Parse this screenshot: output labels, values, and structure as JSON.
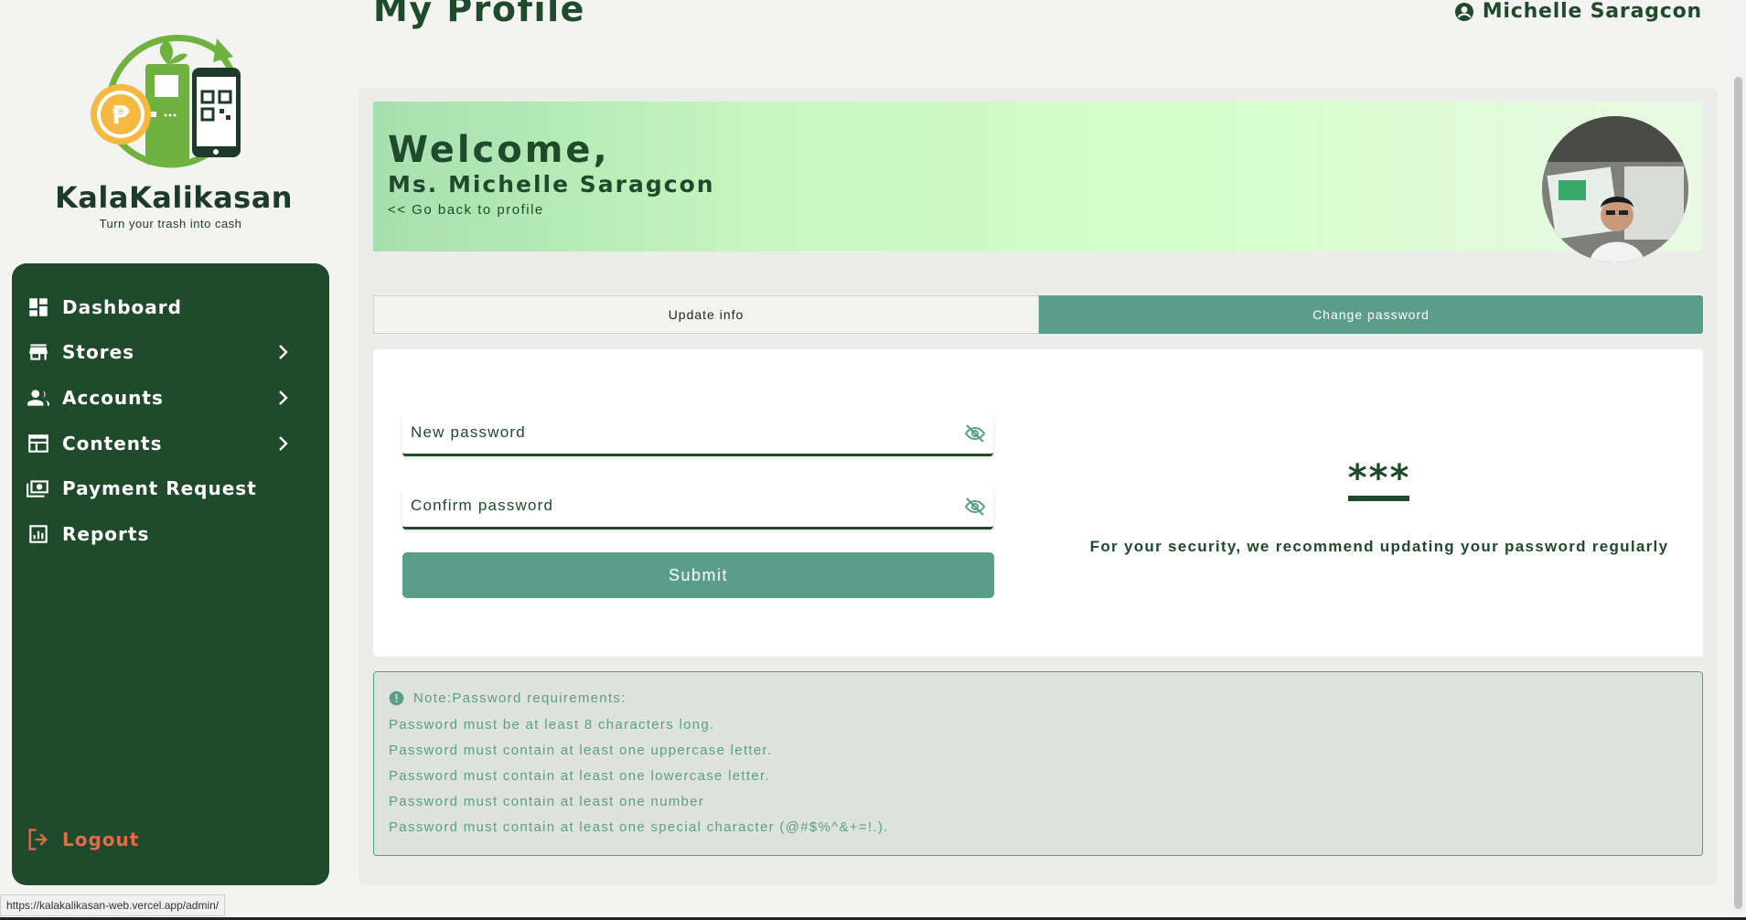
{
  "brand": {
    "name": "KalaKalikasan",
    "tagline": "Turn your trash into cash"
  },
  "sidebar": {
    "items": [
      {
        "label": "Dashboard",
        "icon": "dashboard-icon",
        "has_submenu": false
      },
      {
        "label": "Stores",
        "icon": "store-icon",
        "has_submenu": true
      },
      {
        "label": "Accounts",
        "icon": "people-icon",
        "has_submenu": true
      },
      {
        "label": "Contents",
        "icon": "calendar-table-icon",
        "has_submenu": true
      },
      {
        "label": "Payment Request",
        "icon": "payment-icon",
        "has_submenu": false
      },
      {
        "label": "Reports",
        "icon": "bar-chart-icon",
        "has_submenu": false
      }
    ],
    "logout_label": "Logout"
  },
  "header": {
    "page_title": "My Profile",
    "user_name": "Michelle Saragcon"
  },
  "banner": {
    "greeting": "Welcome,",
    "full_name": "Ms. Michelle Saragcon",
    "back_link": "<< Go back to profile"
  },
  "tabs": {
    "update_info": "Update info",
    "change_password": "Change password",
    "active": "change_password"
  },
  "form": {
    "new_password_placeholder": "New password",
    "confirm_password_placeholder": "Confirm password",
    "submit_label": "Submit"
  },
  "security": {
    "stars": "***",
    "message": "For your security, we recommend updating your password regularly"
  },
  "note": {
    "heading": "Note:Password requirements:",
    "requirements": [
      "Password must be at least 8 characters long.",
      "Password must contain at least one uppercase letter.",
      "Password must contain at least one lowercase letter.",
      "Password must contain at least one number",
      "Password must contain at least one special character (@#$%^&+=!.)."
    ]
  },
  "status_bar": {
    "url": "https://kalakalikasan-web.vercel.app/admin/"
  },
  "colors": {
    "sidebar_bg": "#1f4a2b",
    "accent": "#5a9e8a",
    "logout": "#e46a4a",
    "note_bg": "#dde2dc"
  }
}
